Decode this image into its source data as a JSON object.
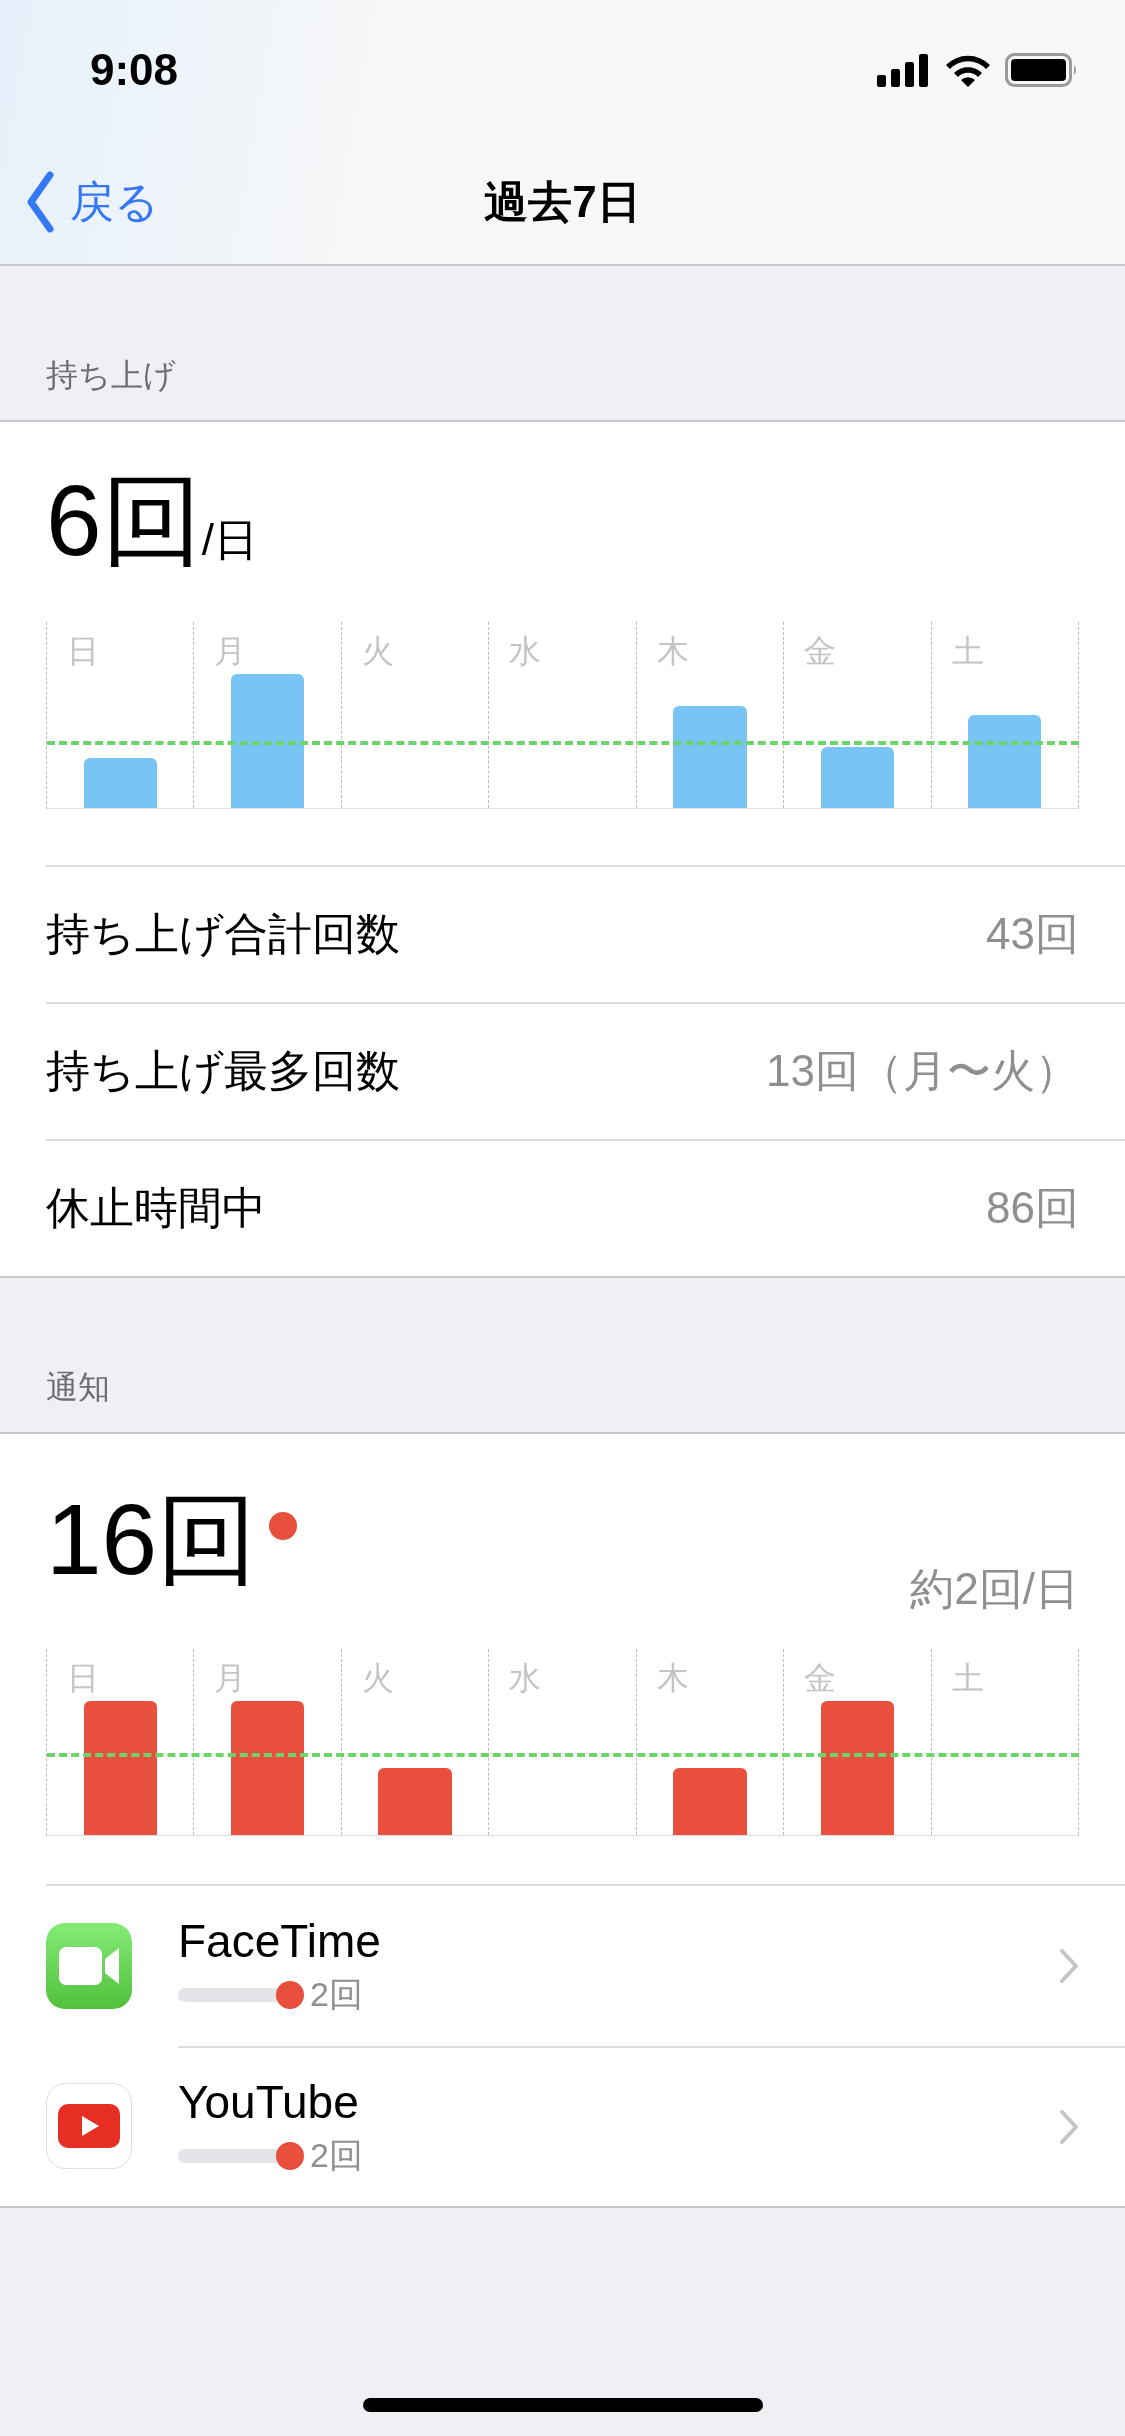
{
  "status_bar": {
    "time": "9:08"
  },
  "nav": {
    "back": "戻る",
    "title": "過去7日"
  },
  "pickups": {
    "header": "持ち上げ",
    "value": "6回",
    "unit": "/日",
    "days": [
      "日",
      "月",
      "火",
      "水",
      "木",
      "金",
      "土"
    ],
    "rows": [
      {
        "label": "持ち上げ合計回数",
        "value": "43回"
      },
      {
        "label": "持ち上げ最多回数",
        "value": "13回（月〜火）"
      },
      {
        "label": "休止時間中",
        "value": "86回"
      }
    ]
  },
  "notifications": {
    "header": "通知",
    "value": "16回",
    "badge": true,
    "average": "約2回/日",
    "days": [
      "日",
      "月",
      "火",
      "水",
      "木",
      "金",
      "土"
    ],
    "apps": [
      {
        "name": "FaceTime",
        "kind": "facetime",
        "count": "2回"
      },
      {
        "name": "YouTube",
        "kind": "youtube",
        "count": "2回"
      }
    ]
  }
}
